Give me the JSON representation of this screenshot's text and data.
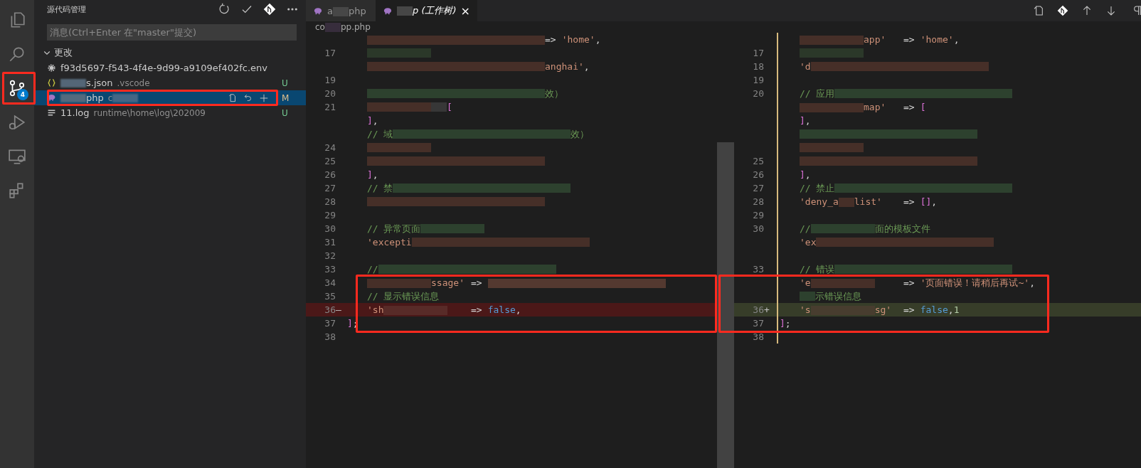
{
  "activity_bar": {
    "items": [
      {
        "kind": "explorer",
        "selected": false,
        "framed": false
      },
      {
        "kind": "search",
        "selected": false,
        "framed": false
      },
      {
        "kind": "source_control",
        "selected": true,
        "framed": true,
        "badge": "4"
      },
      {
        "kind": "run",
        "selected": false,
        "framed": false
      },
      {
        "kind": "remote",
        "selected": false,
        "framed": false
      },
      {
        "kind": "extensions",
        "selected": false,
        "framed": false
      }
    ]
  },
  "sidebar": {
    "title": "源代码管理",
    "commit": {
      "placeholder": "消息(Ctrl+Enter 在\"master\"提交)"
    },
    "section": {
      "title": "更改",
      "expanded": true
    },
    "files": [
      {
        "kind": "gear",
        "name": "f93d5697-f543-4f4e-9d99-a9109ef402fc.env",
        "redacted_prefix": false,
        "redacted_suffix": false,
        "selected": false,
        "framed": false
      },
      {
        "kind": "json",
        "name": "s.json",
        "path": ".vscode",
        "status": "U",
        "redacted_prefix": true,
        "redacted_suffix": false,
        "selected": false,
        "framed": false
      },
      {
        "kind": "php",
        "name": "php",
        "path": "c",
        "status": "M",
        "redacted_prefix": true,
        "redacted_suffix": true,
        "selected": true,
        "framed": true
      },
      {
        "kind": "log",
        "name": "11.log",
        "path": "runtime\\home\\log\\202009",
        "status": "U",
        "redacted_prefix": false,
        "redacted_suffix": false,
        "selected": false,
        "framed": false
      }
    ]
  },
  "tabs": [
    {
      "parts": [
        {
          "kind": "plain",
          "text": "a"
        },
        {
          "kind": "smudge",
          "color": "#4a4a4a"
        },
        {
          "kind": "plain",
          "text": "php"
        }
      ],
      "selected": false,
      "preview": false
    },
    {
      "parts": [
        {
          "kind": "smudge",
          "color": "#4a4a4a"
        },
        {
          "kind": "plain",
          "text": "p (工作树)"
        }
      ],
      "selected": true,
      "preview": true,
      "close": "×"
    }
  ],
  "breadcrumb": {
    "parts": [
      {
        "kind": "plain",
        "text": "co"
      },
      {
        "kind": "smudge",
        "color": "#3a2f3f"
      },
      {
        "kind": "plain",
        "text": "pp.php"
      }
    ]
  },
  "panes": [
    {
      "lines": [
        {
          "framed": false,
          "parts": [
            {
              "kind": "band",
              "color": "#4a3129"
            },
            {
              "kind": "operator",
              "text": "=>"
            },
            {
              "kind": "string",
              "text": "'home'"
            },
            {
              "kind": "punct",
              "text": ","
            }
          ]
        },
        {
          "number": "17",
          "framed": false,
          "parts": [
            {
              "kind": "blur",
              "color": "#2c3b2a"
            }
          ]
        },
        {
          "framed": false,
          "parts": [
            {
              "kind": "band",
              "color": "#4a3129"
            },
            {
              "kind": "string",
              "text": "anghai'"
            },
            {
              "kind": "punct",
              "text": ","
            }
          ]
        },
        {
          "number": "19",
          "framed": false
        },
        {
          "number": "20",
          "framed": false,
          "parts": [
            {
              "kind": "band",
              "color": "#2f4530"
            },
            {
              "kind": "comment",
              "text": "效）"
            }
          ]
        },
        {
          "number": "21",
          "framed": false,
          "parts": [
            {
              "kind": "blur",
              "color": "#4a3129"
            },
            {
              "kind": "smudge",
              "color": "#3a3a3a"
            },
            {
              "kind": "bracket",
              "text": "["
            }
          ]
        },
        {
          "framed": false,
          "parts": [
            {
              "kind": "bracket",
              "text": "]"
            },
            {
              "kind": "punct",
              "text": ","
            }
          ]
        },
        {
          "framed": false,
          "parts": [
            {
              "kind": "comment",
              "text": "// 域"
            },
            {
              "kind": "band",
              "color": "#2f4530"
            },
            {
              "kind": "comment",
              "text": "效）"
            }
          ]
        },
        {
          "number": "24",
          "framed": false,
          "parts": [
            {
              "kind": "blur",
              "color": "#4a3129"
            }
          ]
        },
        {
          "number": "25",
          "framed": false,
          "parts": [
            {
              "kind": "band",
              "color": "#4a3129"
            }
          ]
        },
        {
          "number": "26",
          "framed": false,
          "parts": [
            {
              "kind": "bracket",
              "text": "]"
            },
            {
              "kind": "punct",
              "text": ","
            }
          ]
        },
        {
          "number": "27",
          "framed": false,
          "parts": [
            {
              "kind": "comment",
              "text": "// 禁"
            },
            {
              "kind": "band",
              "color": "#2f4530"
            }
          ]
        },
        {
          "number": "28",
          "framed": false,
          "parts": [
            {
              "kind": "band",
              "color": "#4a3129"
            }
          ]
        },
        {
          "number": "29",
          "framed": false
        },
        {
          "number": "30",
          "framed": false,
          "parts": [
            {
              "kind": "comment",
              "text": "// 异常页面"
            },
            {
              "kind": "blur",
              "color": "#2f4530"
            }
          ]
        },
        {
          "number": "31",
          "framed": false,
          "parts": [
            {
              "kind": "string",
              "text": "'excepti"
            },
            {
              "kind": "band",
              "color": "#4a3129"
            }
          ]
        },
        {
          "number": "32",
          "framed": false
        },
        {
          "number": "33",
          "framed": false,
          "parts": [
            {
              "kind": "comment",
              "text": "//"
            },
            {
              "kind": "band",
              "color": "#2f4530"
            }
          ]
        },
        {
          "number": "34",
          "framed": true,
          "parts": [
            {
              "kind": "blur",
              "color": "#4a3129"
            },
            {
              "kind": "string",
              "text": "ssage'"
            },
            {
              "kind": "operator",
              "text": "=>"
            },
            {
              "kind": "band",
              "color": "#5a3c32"
            }
          ]
        },
        {
          "number": "35",
          "framed": true,
          "parts": [
            {
              "kind": "comment",
              "text": "// 显示错误信息"
            }
          ]
        },
        {
          "number": "36",
          "sign": "—",
          "kind": "removed",
          "framed": true,
          "parts": [
            {
              "kind": "string",
              "text": "'sh"
            },
            {
              "kind": "blur",
              "color": "#5a2e2a"
            },
            {
              "kind": "operator",
              "text": "=>"
            },
            {
              "kind": "keyword",
              "text": "false"
            },
            {
              "kind": "punct",
              "text": ","
            }
          ]
        },
        {
          "number": "37",
          "framed": true,
          "outdented": true,
          "parts": [
            {
              "kind": "bracket",
              "text": "]"
            },
            {
              "kind": "punct",
              "text": ";"
            }
          ]
        },
        {
          "number": "38",
          "framed": false
        }
      ]
    },
    {
      "lines": [
        {
          "framed": false,
          "parts": [
            {
              "kind": "blur",
              "color": "#4a3129"
            },
            {
              "kind": "string",
              "text": "app'"
            },
            {
              "kind": "operator",
              "text": "=>"
            },
            {
              "kind": "string",
              "text": "'home'"
            },
            {
              "kind": "punct",
              "text": ","
            }
          ]
        },
        {
          "number": "17",
          "framed": false,
          "parts": [
            {
              "kind": "blur",
              "color": "#2c3b2a"
            }
          ]
        },
        {
          "number": "18",
          "framed": false,
          "parts": [
            {
              "kind": "string",
              "text": "'d"
            },
            {
              "kind": "band",
              "color": "#4a3129"
            }
          ]
        },
        {
          "number": "19",
          "framed": false
        },
        {
          "number": "20",
          "framed": false,
          "parts": [
            {
              "kind": "comment",
              "text": "// 应用"
            },
            {
              "kind": "band",
              "color": "#2f4530"
            }
          ]
        },
        {
          "framed": false,
          "parts": [
            {
              "kind": "blur",
              "color": "#4a3129"
            },
            {
              "kind": "string",
              "text": "map'"
            },
            {
              "kind": "operator",
              "text": "=>"
            },
            {
              "kind": "bracket",
              "text": "["
            }
          ]
        },
        {
          "framed": false,
          "parts": [
            {
              "kind": "bracket",
              "text": "]"
            },
            {
              "kind": "punct",
              "text": ","
            }
          ]
        },
        {
          "framed": false,
          "parts": [
            {
              "kind": "band",
              "color": "#2f4530"
            }
          ]
        },
        {
          "framed": false,
          "parts": [
            {
              "kind": "blur",
              "color": "#4a3129"
            }
          ]
        },
        {
          "number": "25",
          "framed": false,
          "parts": [
            {
              "kind": "band",
              "color": "#4a3129"
            }
          ]
        },
        {
          "number": "26",
          "framed": false,
          "parts": [
            {
              "kind": "bracket",
              "text": "]"
            },
            {
              "kind": "punct",
              "text": ","
            }
          ]
        },
        {
          "number": "27",
          "framed": false,
          "parts": [
            {
              "kind": "comment",
              "text": "// 禁止"
            },
            {
              "kind": "band",
              "color": "#2f4530"
            }
          ]
        },
        {
          "number": "28",
          "framed": false,
          "parts": [
            {
              "kind": "string",
              "text": "'deny_a"
            },
            {
              "kind": "smudge",
              "color": "#4a3129"
            },
            {
              "kind": "string",
              "text": "list'"
            },
            {
              "kind": "operator",
              "text": "=>"
            },
            {
              "kind": "bracket",
              "text": "[]"
            },
            {
              "kind": "punct",
              "text": ","
            }
          ]
        },
        {
          "number": "29",
          "framed": false
        },
        {
          "number": "30",
          "framed": false,
          "parts": [
            {
              "kind": "comment",
              "text": "//"
            },
            {
              "kind": "blur",
              "color": "#2f4530"
            },
            {
              "kind": "comment",
              "text": "面的模板文件"
            }
          ]
        },
        {
          "framed": false,
          "parts": [
            {
              "kind": "string",
              "text": "'ex"
            },
            {
              "kind": "band",
              "color": "#4a3129"
            }
          ]
        },
        {
          "framed": false
        },
        {
          "number": "33",
          "framed": false,
          "parts": [
            {
              "kind": "comment",
              "text": "// 错误"
            },
            {
              "kind": "band",
              "color": "#2f4530"
            }
          ]
        },
        {
          "framed": true,
          "parts": [
            {
              "kind": "string",
              "text": "'e"
            },
            {
              "kind": "blur",
              "color": "#4a3129"
            },
            {
              "kind": "operator",
              "text": "=>"
            },
            {
              "kind": "string",
              "text": "'页面错误！请稍后再试~'"
            },
            {
              "kind": "punct",
              "text": ","
            }
          ]
        },
        {
          "framed": true,
          "parts": [
            {
              "kind": "smudge",
              "color": "#2f4530"
            },
            {
              "kind": "comment",
              "text": "示错误信息"
            }
          ]
        },
        {
          "number": "36",
          "sign": "+",
          "kind": "added",
          "framed": true,
          "parts": [
            {
              "kind": "string",
              "text": "'s"
            },
            {
              "kind": "blur",
              "color": "#4a3d30"
            },
            {
              "kind": "string",
              "text": "sg'"
            },
            {
              "kind": "operator",
              "text": "=>"
            },
            {
              "kind": "keyword",
              "text": "false"
            },
            {
              "kind": "punct",
              "text": ","
            },
            {
              "kind": "number",
              "text": "1"
            }
          ]
        },
        {
          "number": "37",
          "framed": true,
          "outdented": true,
          "parts": [
            {
              "kind": "bracket",
              "text": "]"
            },
            {
              "kind": "punct",
              "text": ";"
            }
          ]
        },
        {
          "number": "38",
          "framed": false
        }
      ]
    }
  ]
}
